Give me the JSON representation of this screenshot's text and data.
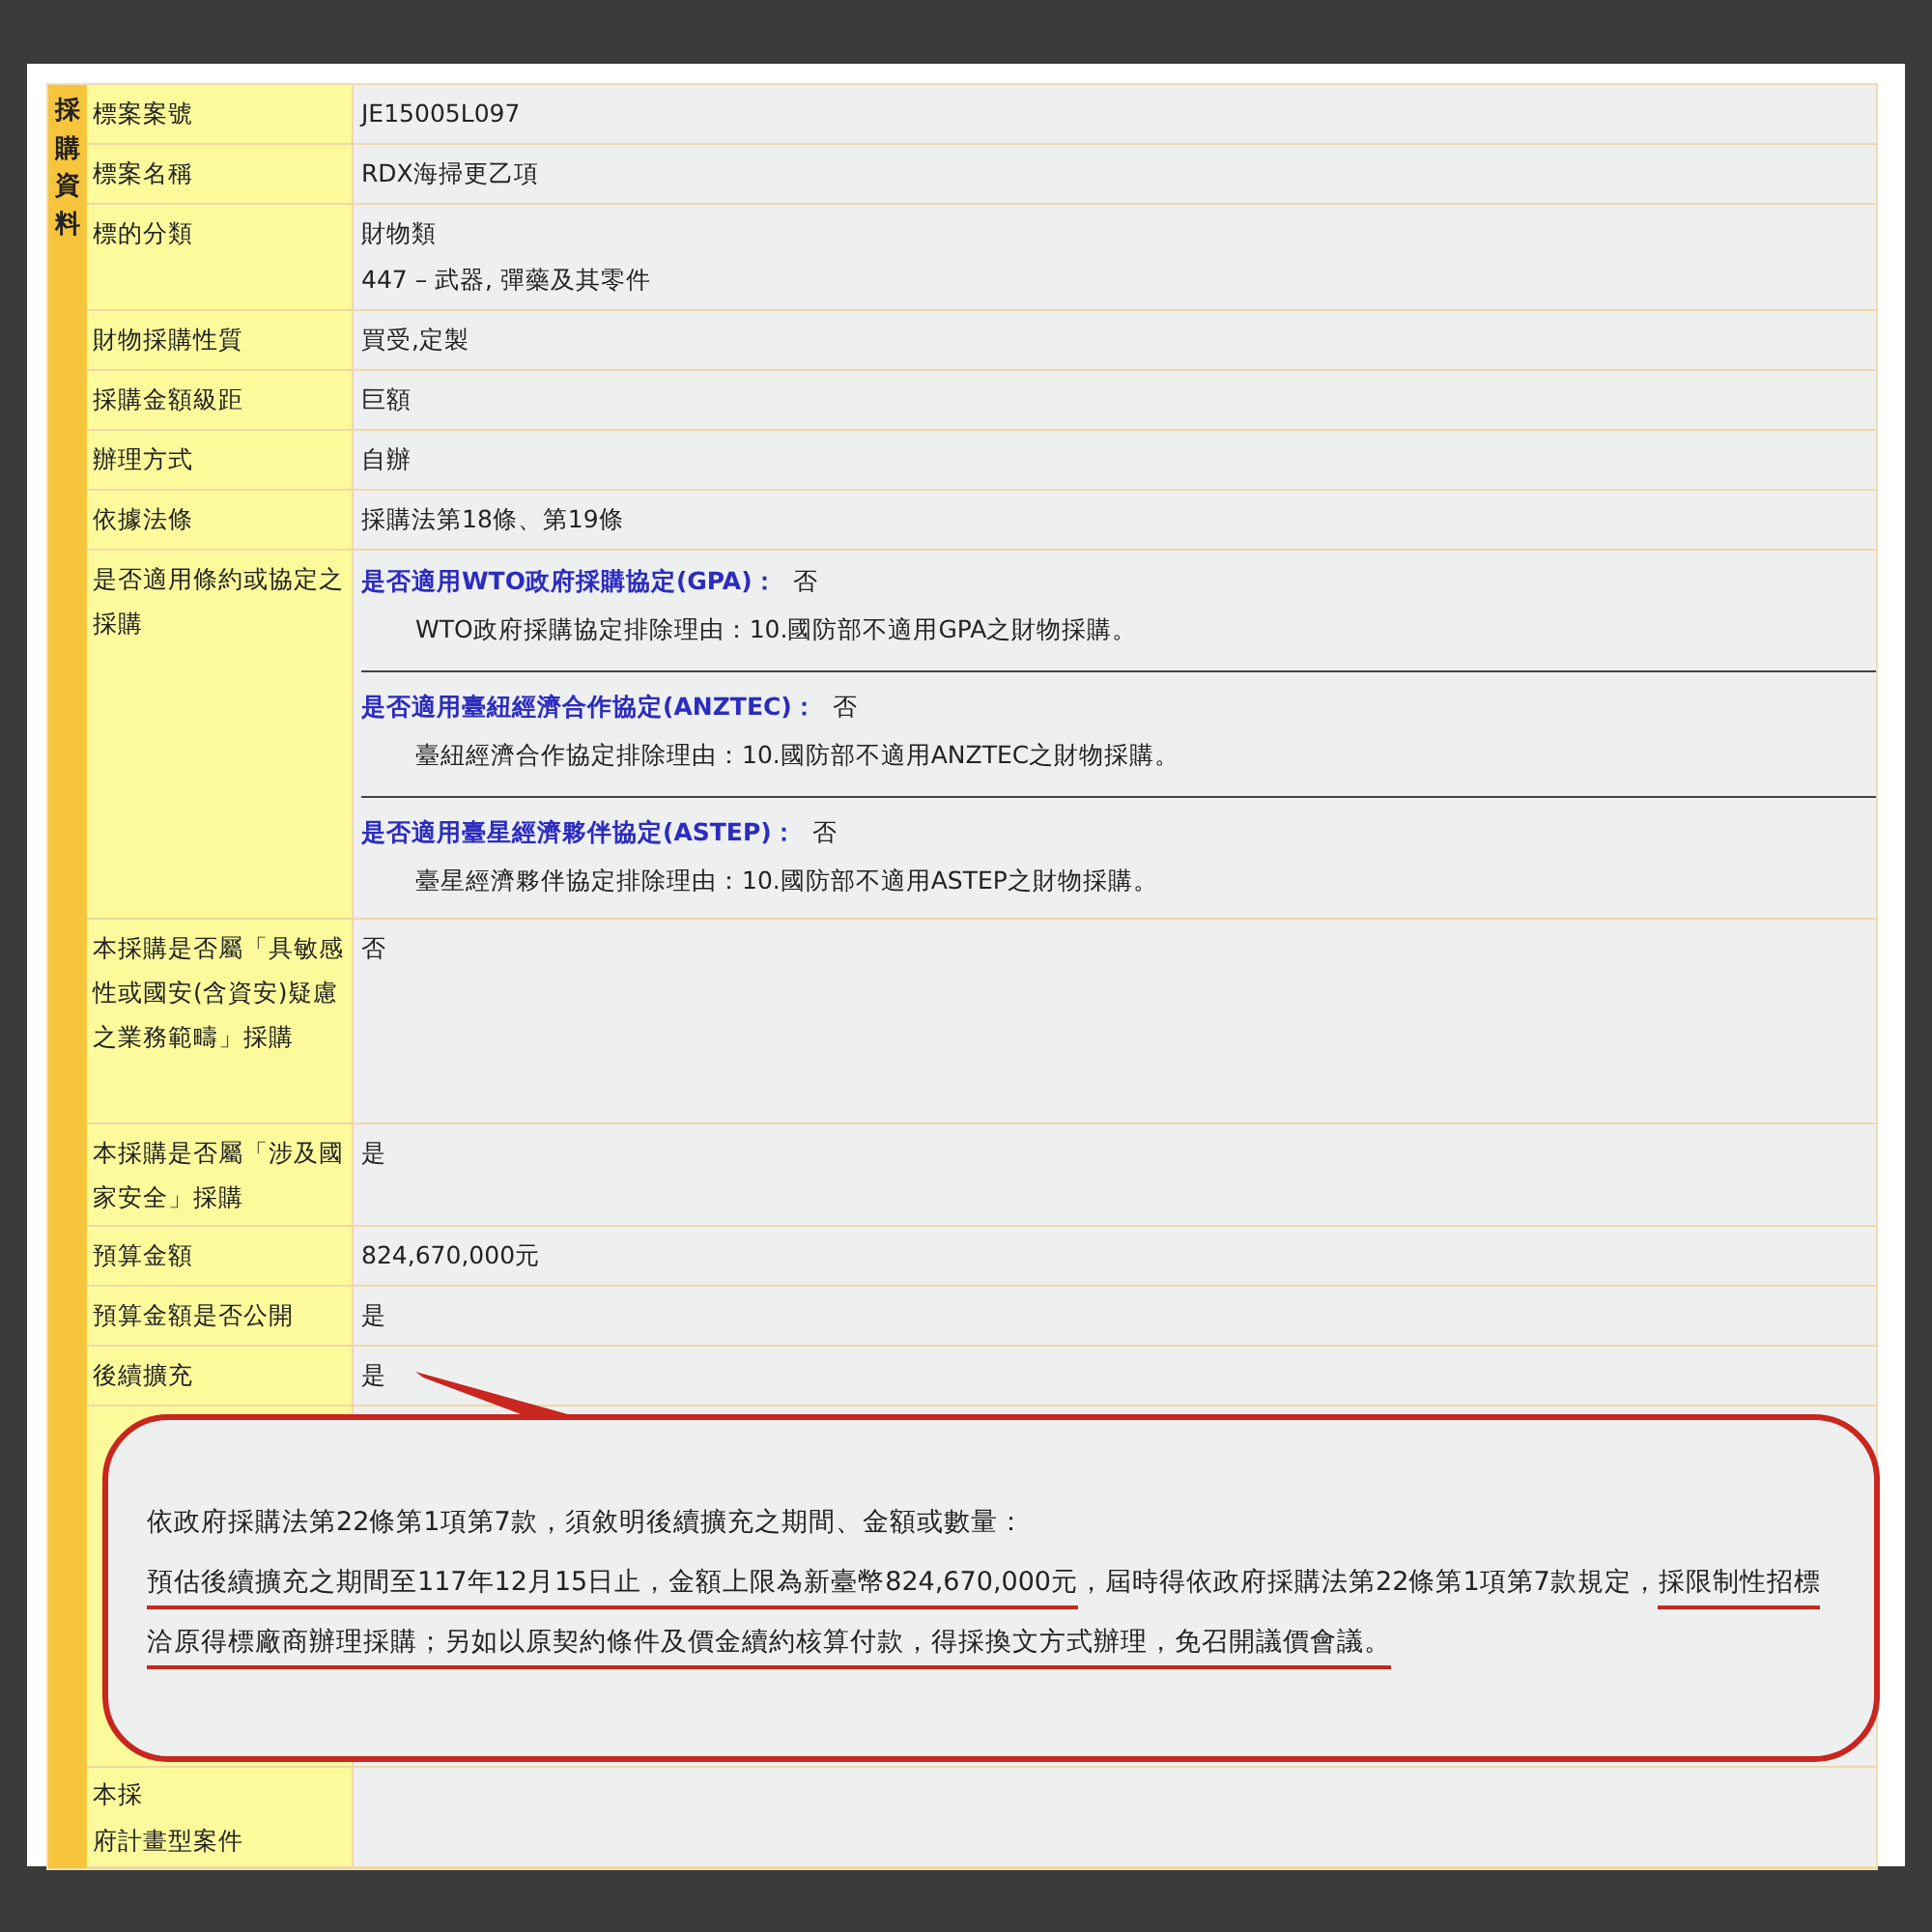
{
  "section_label": "採購資料",
  "rows": [
    {
      "kind": "text",
      "label": "標案案號",
      "values": [
        "JE15005L097"
      ]
    },
    {
      "kind": "text",
      "label": "標案名稱",
      "values": [
        "RDX海掃更乙項"
      ]
    },
    {
      "kind": "text",
      "label": "標的分類",
      "values": [
        "財物類",
        "447 – 武器, 彈藥及其零件"
      ]
    },
    {
      "kind": "text",
      "label": "財物採購性質",
      "values": [
        "買受,定製"
      ]
    },
    {
      "kind": "text",
      "label": "採購金額級距",
      "values": [
        "巨額"
      ]
    },
    {
      "kind": "text",
      "label": "辦理方式",
      "values": [
        "自辦"
      ]
    },
    {
      "kind": "text",
      "label": "依據法條",
      "values": [
        "採購法第18條、第19條"
      ]
    },
    {
      "kind": "agreements",
      "label": "是否適用條約或協定之採購",
      "agreements": [
        {
          "title": "是否適用WTO政府採購協定(GPA)：",
          "answer": "否",
          "reason": "WTO政府採購協定排除理由：10.國防部不適用GPA之財物採購。"
        },
        {
          "title": "是否適用臺紐經濟合作協定(ANZTEC)：",
          "answer": "否",
          "reason": "臺紐經濟合作協定排除理由：10.國防部不適用ANZTEC之財物採購。"
        },
        {
          "title": "是否適用臺星經濟夥伴協定(ASTEP)：",
          "answer": "否",
          "reason": "臺星經濟夥伴協定排除理由：10.國防部不適用ASTEP之財物採購。"
        }
      ]
    },
    {
      "kind": "tall",
      "label": "本採購是否屬「具敏感性或國安(含資安)疑慮之業務範疇」採購",
      "values": [
        "否"
      ]
    },
    {
      "kind": "text",
      "label": "本採購是否屬「涉及國家安全」採購",
      "values": [
        "是"
      ]
    },
    {
      "kind": "text",
      "label": "預算金額",
      "values": [
        "824,670,000元"
      ]
    },
    {
      "kind": "text",
      "label": "預算金額是否公開",
      "values": [
        "是"
      ]
    },
    {
      "kind": "text",
      "label": "後續擴充",
      "values": [
        "是"
      ]
    },
    {
      "kind": "covered",
      "label_lines": []
    },
    {
      "kind": "partial",
      "label_lines": [
        "本採",
        "府計畫型案件"
      ]
    }
  ],
  "callout": {
    "lines": [
      [
        {
          "text": "依政府採購法第22條第1項第7款，須敘明後續擴充之期間、金額或數量：",
          "underlined": false
        }
      ],
      [
        {
          "text": "預估後續擴充之期間至117年12月15日止，金額上限為新臺幣824,670,000元",
          "underlined": true
        },
        {
          "text": "，屆時得依政府採購法第22條第1項第7款規定，",
          "underlined": false
        },
        {
          "text": "採限制性招標洽原得標廠商辦理採購；另如以原契約條件及價金續約核算付款，得採換文方式辦理，免召開議價會議。",
          "underlined": true
        }
      ]
    ]
  }
}
